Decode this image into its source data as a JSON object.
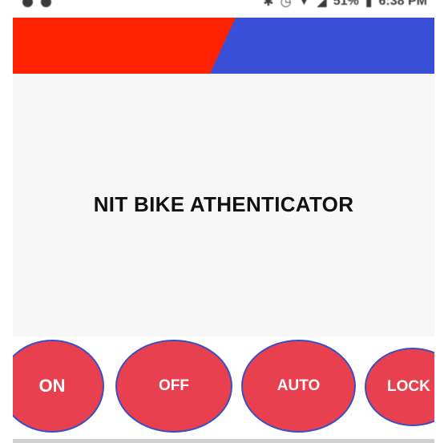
{
  "status_bar": {
    "battery": "51%",
    "time": "6:38 PM"
  },
  "header": {
    "left_color": "#ff2200",
    "right_color": "#3a4fd8"
  },
  "main": {
    "title": "NIT BIKE ATHENTICATOR"
  },
  "buttons": {
    "on_label": "ON",
    "off_label": "OFF",
    "auto_label": "AUTO",
    "lock_label": "LOCK"
  },
  "colors": {
    "button_fill": "#e8404f",
    "button_border": "#3b4fc2",
    "background": "#f7f7f7"
  }
}
